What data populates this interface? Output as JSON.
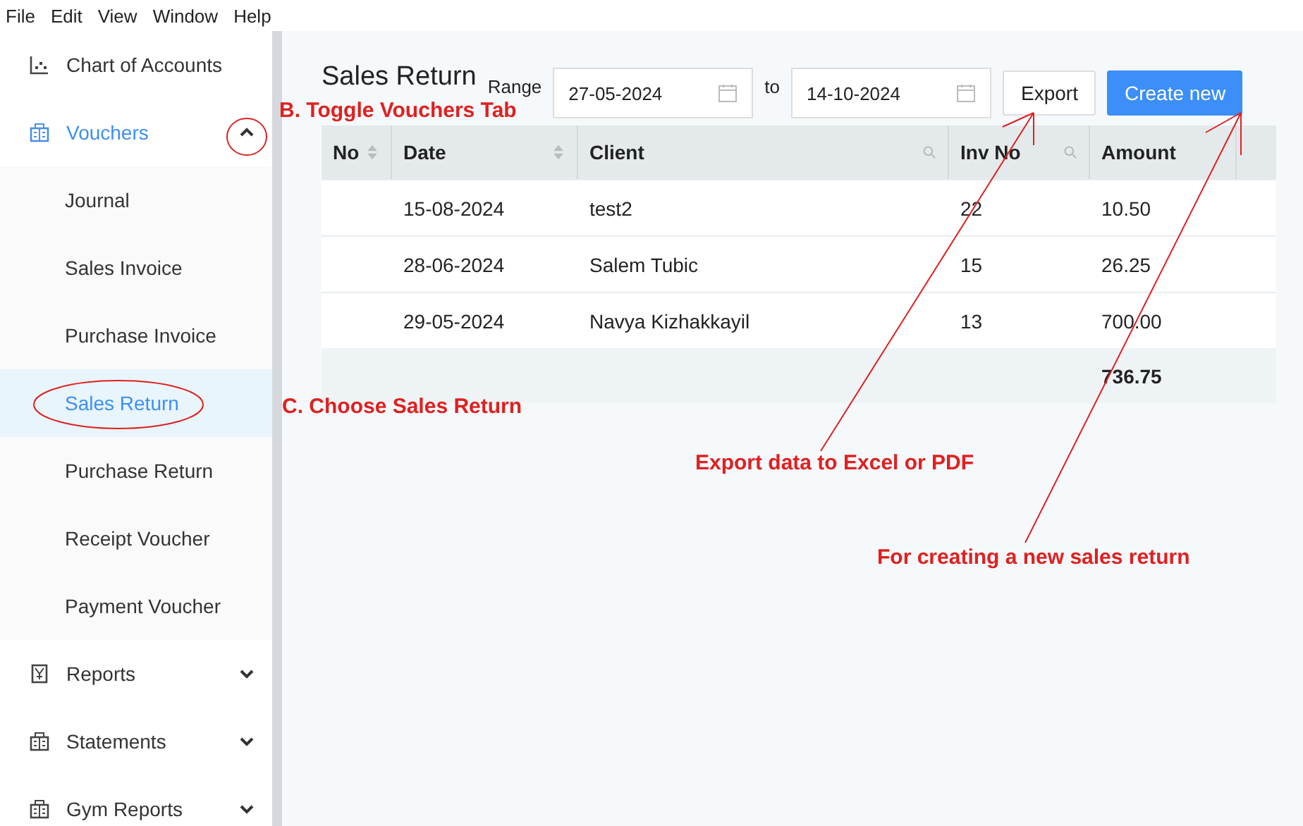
{
  "menu": [
    "File",
    "Edit",
    "View",
    "Window",
    "Help"
  ],
  "sidebar": {
    "items": [
      {
        "label": "Chart of Accounts",
        "kind": "link",
        "selected": false
      },
      {
        "label": "Vouchers",
        "kind": "group",
        "selected": true,
        "expanded": true,
        "children": [
          {
            "label": "Journal",
            "selected": false
          },
          {
            "label": "Sales Invoice",
            "selected": false
          },
          {
            "label": "Purchase Invoice",
            "selected": false
          },
          {
            "label": "Sales Return",
            "selected": true
          },
          {
            "label": "Purchase Return",
            "selected": false
          },
          {
            "label": "Receipt Voucher",
            "selected": false
          },
          {
            "label": "Payment Voucher",
            "selected": false
          }
        ]
      },
      {
        "label": "Reports",
        "kind": "group",
        "selected": false,
        "expanded": false
      },
      {
        "label": "Statements",
        "kind": "group",
        "selected": false,
        "expanded": false
      },
      {
        "label": "Gym Reports",
        "kind": "group",
        "selected": false,
        "expanded": false
      }
    ]
  },
  "page": {
    "title": "Sales Return",
    "range_label": "Range",
    "date_from": "27-05-2024",
    "to_label": "to",
    "date_to": "14-10-2024",
    "buttons": [
      {
        "label": "Export",
        "kind": "secondary"
      },
      {
        "label": "Create new",
        "kind": "primary"
      }
    ]
  },
  "table": {
    "columns": [
      {
        "label": "No",
        "kind": "sort"
      },
      {
        "label": "Date",
        "kind": "sort"
      },
      {
        "label": "Client",
        "kind": "search"
      },
      {
        "label": "Inv No",
        "kind": "search"
      },
      {
        "label": "Amount",
        "kind": "plain"
      }
    ],
    "rows": [
      [
        "",
        "15-08-2024",
        "test2",
        "22",
        "10.50"
      ],
      [
        "",
        "28-06-2024",
        "Salem Tubic",
        "15",
        "26.25"
      ],
      [
        "",
        "29-05-2024",
        "Navya Kizhakkayil",
        "13",
        "700.00"
      ]
    ],
    "total": "736.75"
  },
  "annotations": [
    "B. Toggle Vouchers Tab",
    "C. Choose Sales Return",
    "Export data to Excel or PDF",
    "For creating a new sales return"
  ]
}
